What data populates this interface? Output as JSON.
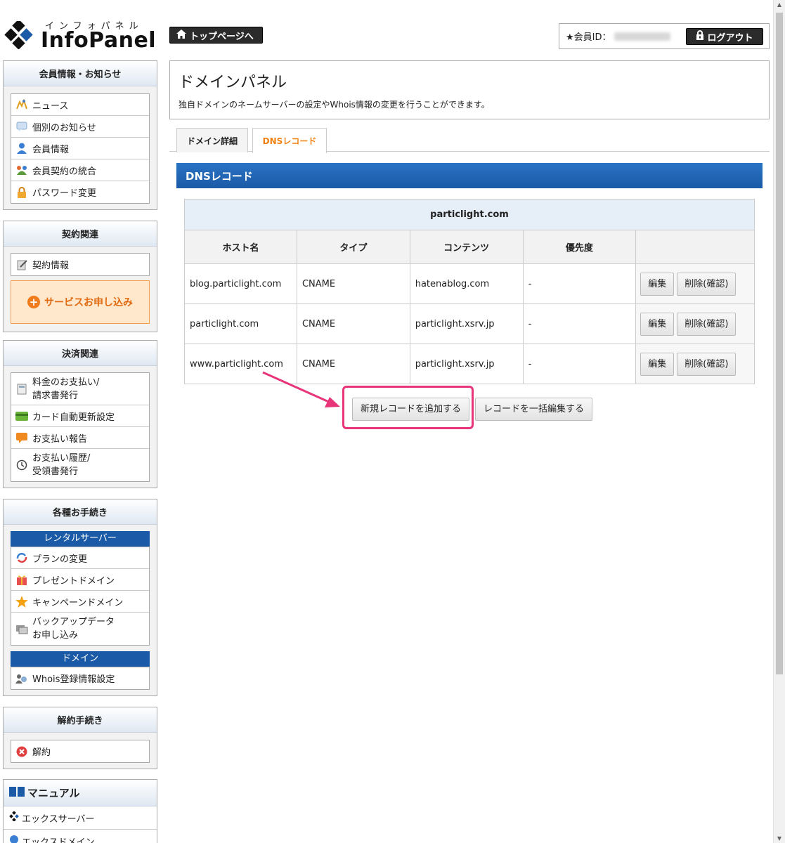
{
  "header": {
    "logo_kana": "インフォパネル",
    "logo_text": "InfoPanel",
    "top_button": "トップページへ",
    "member_label": "★会員ID：",
    "logout_button": "ログアウト"
  },
  "sidebar": {
    "member_section": {
      "title": "会員情報・お知らせ",
      "items": [
        {
          "label": "ニュース",
          "icon": "news-icon"
        },
        {
          "label": "個別のお知らせ",
          "icon": "message-icon"
        },
        {
          "label": "会員情報",
          "icon": "user-icon"
        },
        {
          "label": "会員契約の統合",
          "icon": "merge-icon"
        },
        {
          "label": "パスワード変更",
          "icon": "lock-icon"
        }
      ]
    },
    "contract_section": {
      "title": "契約関連",
      "items": [
        {
          "label": "契約情報",
          "icon": "contract-icon"
        }
      ],
      "service_button": "サービスお申し込み"
    },
    "payment_section": {
      "title": "決済関連",
      "items": [
        {
          "label": "料金のお支払い/\n請求書発行",
          "icon": "calculator-icon"
        },
        {
          "label": "カード自動更新設定",
          "icon": "card-icon"
        },
        {
          "label": "お支払い報告",
          "icon": "report-icon"
        },
        {
          "label": "お支払い履歴/\n受領書発行",
          "icon": "clock-icon"
        }
      ]
    },
    "procedure_section": {
      "title": "各種お手続き",
      "rental_head": "レンタルサーバー",
      "rental_items": [
        {
          "label": "プランの変更",
          "icon": "refresh-icon"
        },
        {
          "label": "プレゼントドメイン",
          "icon": "gift-icon"
        },
        {
          "label": "キャンペーンドメイン",
          "icon": "star-icon"
        },
        {
          "label": "バックアップデータ\nお申し込み",
          "icon": "backup-icon"
        }
      ],
      "domain_head": "ドメイン",
      "domain_items": [
        {
          "label": "Whois登録情報設定",
          "icon": "whois-icon"
        }
      ]
    },
    "cancel_section": {
      "title": "解約手続き",
      "items": [
        {
          "label": "解約",
          "icon": "cancel-icon"
        }
      ]
    },
    "manual_section": {
      "title": "マニュアル",
      "items": [
        "エックスサーバー",
        "エックスドメイン"
      ]
    }
  },
  "main": {
    "title": "ドメインパネル",
    "description": "独自ドメインのネームサーバーの設定やWhois情報の変更を行うことができます。",
    "tabs": [
      {
        "label": "ドメイン詳細",
        "active": false
      },
      {
        "label": "DNSレコード",
        "active": true
      }
    ],
    "section_title": "DNSレコード",
    "domain": "particlight.com",
    "columns": [
      "ホスト名",
      "タイプ",
      "コンテンツ",
      "優先度",
      ""
    ],
    "rows": [
      {
        "host": "blog.particlight.com",
        "type": "CNAME",
        "content": "hatenablog.com",
        "priority": "-"
      },
      {
        "host": "particlight.com",
        "type": "CNAME",
        "content": "particlight.xsrv.jp",
        "priority": "-"
      },
      {
        "host": "www.particlight.com",
        "type": "CNAME",
        "content": "particlight.xsrv.jp",
        "priority": "-"
      }
    ],
    "row_buttons": {
      "edit": "編集",
      "delete": "削除(確認)"
    },
    "add_button": "新規レコードを追加する",
    "bulk_edit_button": "レコードを一括編集する"
  },
  "colors": {
    "accent_blue": "#1b5aa6",
    "tab_active": "#f08010",
    "highlight": "#e8357a",
    "service_orange": "#ef7b1b"
  }
}
